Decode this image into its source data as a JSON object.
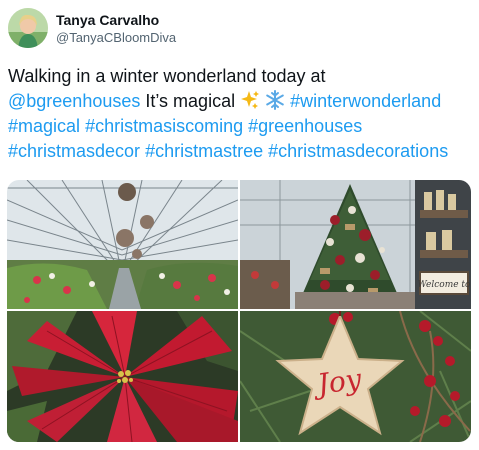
{
  "author": {
    "name": "Tanya Carvalho",
    "handle": "@TanyaCBloomDiva"
  },
  "tweet": {
    "line1": "Walking in a winter wonderland today at",
    "mention": "@bgreenhouses",
    "text2": " It’s magical ",
    "tag1": "#winterwonderland",
    "tag2": "#magical",
    "tag3": "#christmasiscoming",
    "tag4": "#greenhouses",
    "tag5": "#christmasdecor",
    "tag6": "#christmastree",
    "tag7": "#christmasdecorations",
    "emojis": [
      "sparkles-icon",
      "snowflake-icon"
    ]
  },
  "media": {
    "photos": [
      "greenhouse-interior-photo",
      "christmas-tree-photo",
      "poinsettia-photo",
      "joy-star-ornament-photo"
    ],
    "sign_text": "Welcome to",
    "ornament_text": "Joy"
  },
  "colors": {
    "link": "#1d9bf0",
    "text": "#0f1419",
    "secondary": "#536471"
  }
}
